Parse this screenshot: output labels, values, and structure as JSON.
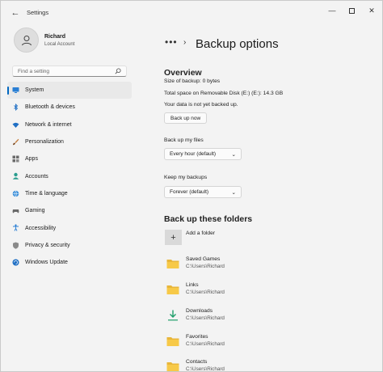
{
  "window": {
    "title": "Settings",
    "back_glyph": "←",
    "controls": {
      "minimize": "—",
      "close": "✕"
    }
  },
  "user": {
    "name": "Richard",
    "account_type": "Local Account"
  },
  "search": {
    "placeholder": "Find a setting",
    "icon": "search-icon"
  },
  "nav": {
    "items": [
      {
        "label": "System",
        "icon": "system-icon",
        "active": true
      },
      {
        "label": "Bluetooth & devices",
        "icon": "bluetooth-icon"
      },
      {
        "label": "Network & internet",
        "icon": "network-icon"
      },
      {
        "label": "Personalization",
        "icon": "brush-icon"
      },
      {
        "label": "Apps",
        "icon": "apps-icon"
      },
      {
        "label": "Accounts",
        "icon": "accounts-icon"
      },
      {
        "label": "Time & language",
        "icon": "globe-icon"
      },
      {
        "label": "Gaming",
        "icon": "gaming-icon"
      },
      {
        "label": "Accessibility",
        "icon": "accessibility-icon"
      },
      {
        "label": "Privacy & security",
        "icon": "shield-icon"
      },
      {
        "label": "Windows Update",
        "icon": "update-icon"
      }
    ]
  },
  "breadcrumb": {
    "more": "•••",
    "separator": "›",
    "title": "Backup options"
  },
  "overview": {
    "heading": "Overview",
    "size": "Size of backup: 0 bytes",
    "space": "Total space on Removable Disk (E:) (E:): 14.3 GB",
    "status": "Your data is not yet backed up.",
    "backup_button": "Back up now"
  },
  "settings": {
    "backup_files_label": "Back up my files",
    "backup_files_value": "Every hour (default)",
    "keep_label": "Keep my backups",
    "keep_value": "Forever (default)",
    "chevron": "⌄"
  },
  "folders": {
    "heading": "Back up these folders",
    "add_label": "Add a folder",
    "add_glyph": "+",
    "items": [
      {
        "name": "Saved Games",
        "path": "C:\\Users\\Richard",
        "icon": "folder-icon"
      },
      {
        "name": "Links",
        "path": "C:\\Users\\Richard",
        "icon": "folder-icon"
      },
      {
        "name": "Downloads",
        "path": "C:\\Users\\Richard",
        "icon": "download-icon"
      },
      {
        "name": "Favorites",
        "path": "C:\\Users\\Richard",
        "icon": "folder-icon"
      },
      {
        "name": "Contacts",
        "path": "C:\\Users\\Richard",
        "icon": "folder-icon"
      }
    ]
  },
  "colors": {
    "accent": "#0067c0",
    "folder": "#f7c948",
    "download": "#1e9e6a"
  }
}
